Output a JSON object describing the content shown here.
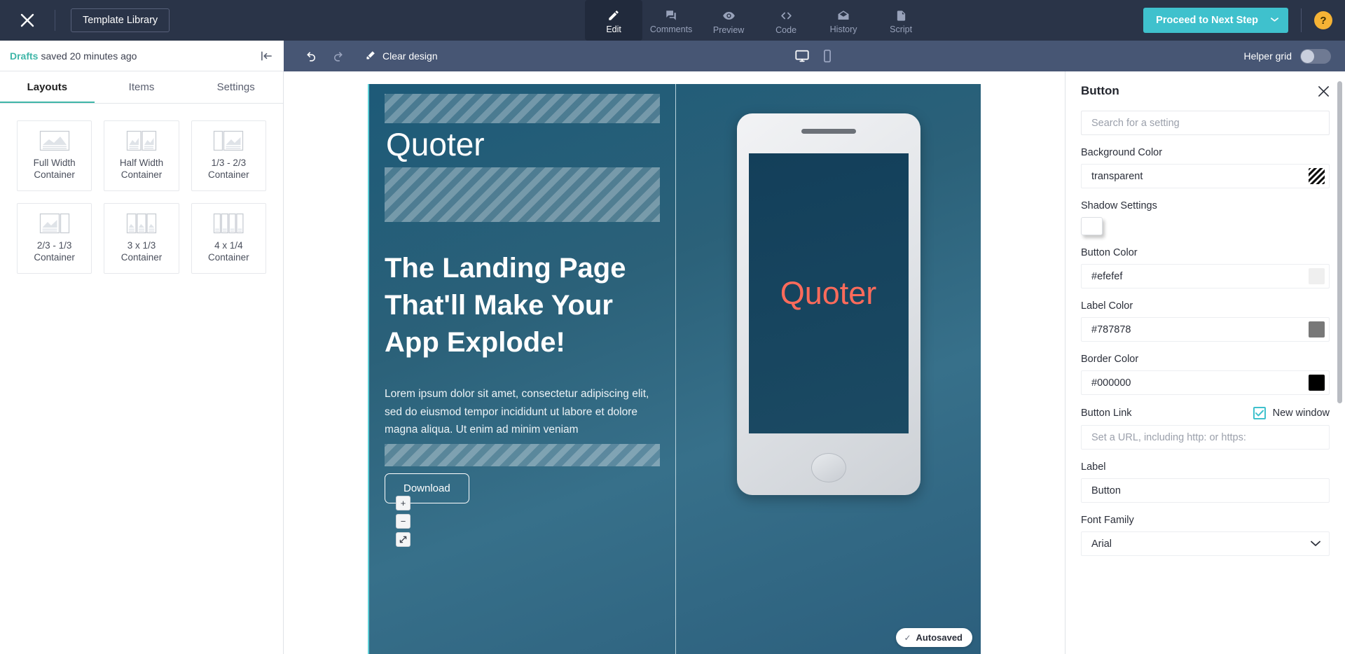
{
  "topbar": {
    "close_icon": "close-x-icon",
    "template_library": "Template Library",
    "tabs": [
      {
        "label": "Edit",
        "icon": "pencil-icon",
        "active": true
      },
      {
        "label": "Comments",
        "icon": "comment-icon",
        "active": false
      },
      {
        "label": "Preview",
        "icon": "eye-icon",
        "active": false
      },
      {
        "label": "Code",
        "icon": "code-brackets-icon",
        "active": false
      },
      {
        "label": "History",
        "icon": "envelope-open-icon",
        "active": false
      },
      {
        "label": "Script",
        "icon": "document-icon",
        "active": false
      }
    ],
    "proceed_label": "Proceed to Next Step",
    "proceed_caret": "⌄",
    "help_label": "?",
    "accent": "#3fc1cd",
    "help_color": "#f5b335",
    "bg": "#2a3448"
  },
  "drafts": {
    "status_word": "Drafts",
    "status_rest": "saved 20 minutes ago",
    "status_color": "#3fb6a8",
    "collapse_icon": "collapse-panel-icon"
  },
  "canvas_toolbar": {
    "undo_icon": "undo-arrow-icon",
    "redo_icon": "redo-arrow-icon",
    "clear_design": "Clear design",
    "clear_icon": "eraser-icon",
    "device_desktop": "desktop-monitor-icon",
    "device_mobile": "mobile-phone-icon",
    "active_device": "desktop",
    "helper_grid_label": "Helper grid",
    "helper_grid_on": false,
    "bg": "#475674"
  },
  "left_panel": {
    "tabs": [
      {
        "label": "Layouts",
        "active": true
      },
      {
        "label": "Items",
        "active": false
      },
      {
        "label": "Settings",
        "active": false
      }
    ],
    "layouts": [
      {
        "label": "Full Width Container",
        "icon": "layout-full-width-icon"
      },
      {
        "label": "Half Width Container",
        "icon": "layout-half-width-icon"
      },
      {
        "label": "1/3 - 2/3 Container",
        "icon": "layout-third-twothird-icon"
      },
      {
        "label": "2/3 - 1/3 Container",
        "icon": "layout-twothird-third-icon"
      },
      {
        "label": "3 x 1/3 Container",
        "icon": "layout-three-thirds-icon"
      },
      {
        "label": "4 x 1/4 Container",
        "icon": "layout-four-quarters-icon"
      }
    ]
  },
  "canvas": {
    "brand": "Quoter",
    "headline": "The Landing Page That'll Make Your App Explode!",
    "subcopy": "Lorem ipsum dolor sit amet, consectetur adipiscing elit, sed do eiusmod tempor incididunt ut labore et dolore magna aliqua. Ut enim ad minim veniam",
    "download_label": "Download",
    "zoom_in": "+",
    "zoom_out": "−",
    "zoom_fit": "↗",
    "phone_screen_text": "Quoter",
    "phone_screen_text_color": "#ff6b5b",
    "autosaved_label": "Autosaved",
    "autosaved_check": "✓"
  },
  "right_panel": {
    "title": "Button",
    "close_icon": "close-icon",
    "search_placeholder": "Search for a setting",
    "search_value": "",
    "fields": {
      "background_color_label": "Background Color",
      "background_color_value": "transparent",
      "shadow_settings_label": "Shadow Settings",
      "button_color_label": "Button Color",
      "button_color_value": "#efefef",
      "label_color_label": "Label Color",
      "label_color_value": "#787878",
      "border_color_label": "Border Color",
      "border_color_value": "#000000",
      "button_link_label": "Button Link",
      "new_window_label": "New window",
      "new_window_checked": true,
      "button_link_placeholder": "Set a URL, including http: or https:",
      "button_link_value": "",
      "label_label": "Label",
      "label_value": "Button",
      "font_family_label": "Font Family",
      "font_family_value": "Arial",
      "font_family_caret": "⌄"
    }
  }
}
